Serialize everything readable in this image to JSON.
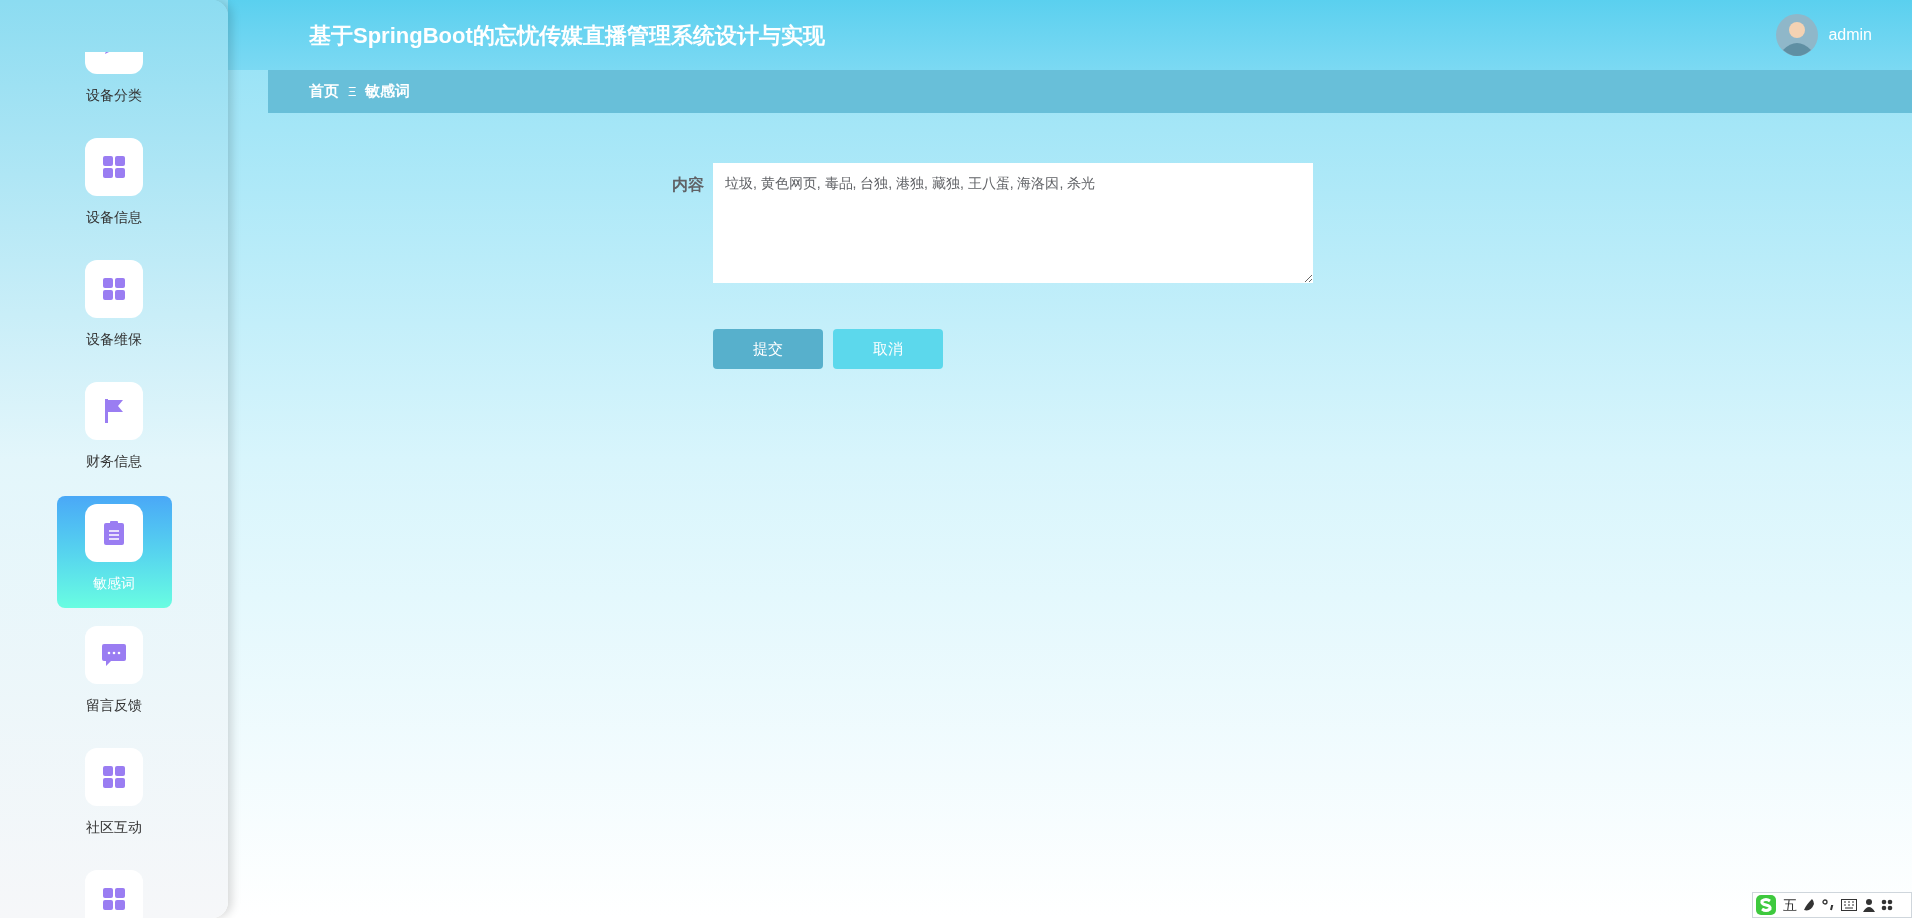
{
  "sidebar": {
    "items": [
      {
        "label": "设备分类",
        "kind": "send",
        "selected": false
      },
      {
        "label": "设备信息",
        "kind": "grid",
        "selected": false
      },
      {
        "label": "设备维保",
        "kind": "grid",
        "selected": false
      },
      {
        "label": "财务信息",
        "kind": "flag",
        "selected": false
      },
      {
        "label": "敏感词",
        "kind": "clipboard",
        "selected": true
      },
      {
        "label": "留言反馈",
        "kind": "chat",
        "selected": false
      },
      {
        "label": "社区互动",
        "kind": "grid",
        "selected": false
      },
      {
        "kind": "grid",
        "selected": false
      }
    ]
  },
  "header": {
    "title": "基于SpringBoot的忘忧传媒直播管理系统设计与实现",
    "user": "admin"
  },
  "breadcrumb": {
    "items": [
      "首页",
      "敏感词"
    ],
    "separator": "Ξ"
  },
  "form": {
    "fields": [
      {
        "label": "内容",
        "value": "垃圾, 黄色网页, 毒品, 台独, 港独, 藏独, 王八蛋, 海洛因, 杀光"
      }
    ],
    "buttons": [
      {
        "label": "提交",
        "kind": "primary"
      },
      {
        "label": "取消",
        "kind": "secondary"
      }
    ]
  },
  "ime_bar": {
    "mode": "五"
  }
}
